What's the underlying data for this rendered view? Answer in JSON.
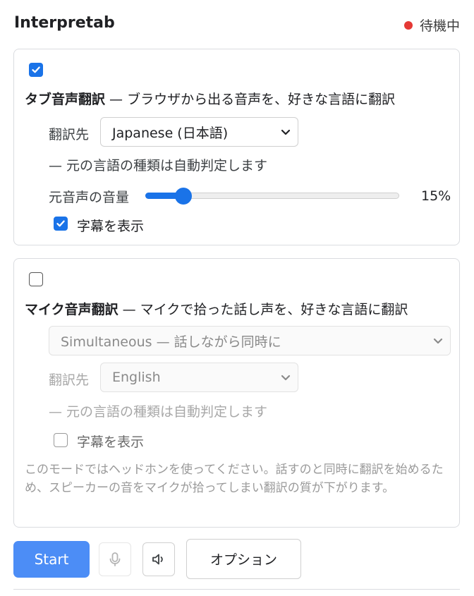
{
  "header": {
    "title": "Interpretab",
    "status": "待機中",
    "status_color": "#e53935"
  },
  "tab_translation": {
    "enabled": true,
    "feature_name": "タブ音声翻訳",
    "description": " — ブラウザから出る音声を、好きな言語に翻訳",
    "target_label": "翻訳先",
    "target_value": "Japanese (日本語)",
    "auto_detect_note": "— 元の言語の種類は自動判定します",
    "volume_label": "元音声の音量",
    "volume_value": "15%",
    "volume_fraction": 0.15,
    "subtitles_checked": true,
    "subtitles_label": "字幕を表示"
  },
  "mic_translation": {
    "enabled": false,
    "feature_name": "マイク音声翻訳",
    "description": " — マイクで拾った話し声を、好きな言語に翻訳",
    "mode_value": "Simultaneous — 話しながら同時に",
    "target_label": "翻訳先",
    "target_value": "English",
    "auto_detect_note": "— 元の言語の種類は自動判定します",
    "subtitles_checked": false,
    "subtitles_label": "字幕を表示",
    "note": "このモードではヘッドホンを使ってください。話すのと同時に翻訳を始めるため、スピーカーの音をマイクが拾ってしまい翻訳の質が下がります。"
  },
  "toolbar": {
    "start_label": "Start",
    "mic_icon": "microphone-icon",
    "speaker_icon": "speaker-icon",
    "options_label": "オプション"
  },
  "colors": {
    "accent": "#1a73e8",
    "start_button": "#4c8df6"
  }
}
